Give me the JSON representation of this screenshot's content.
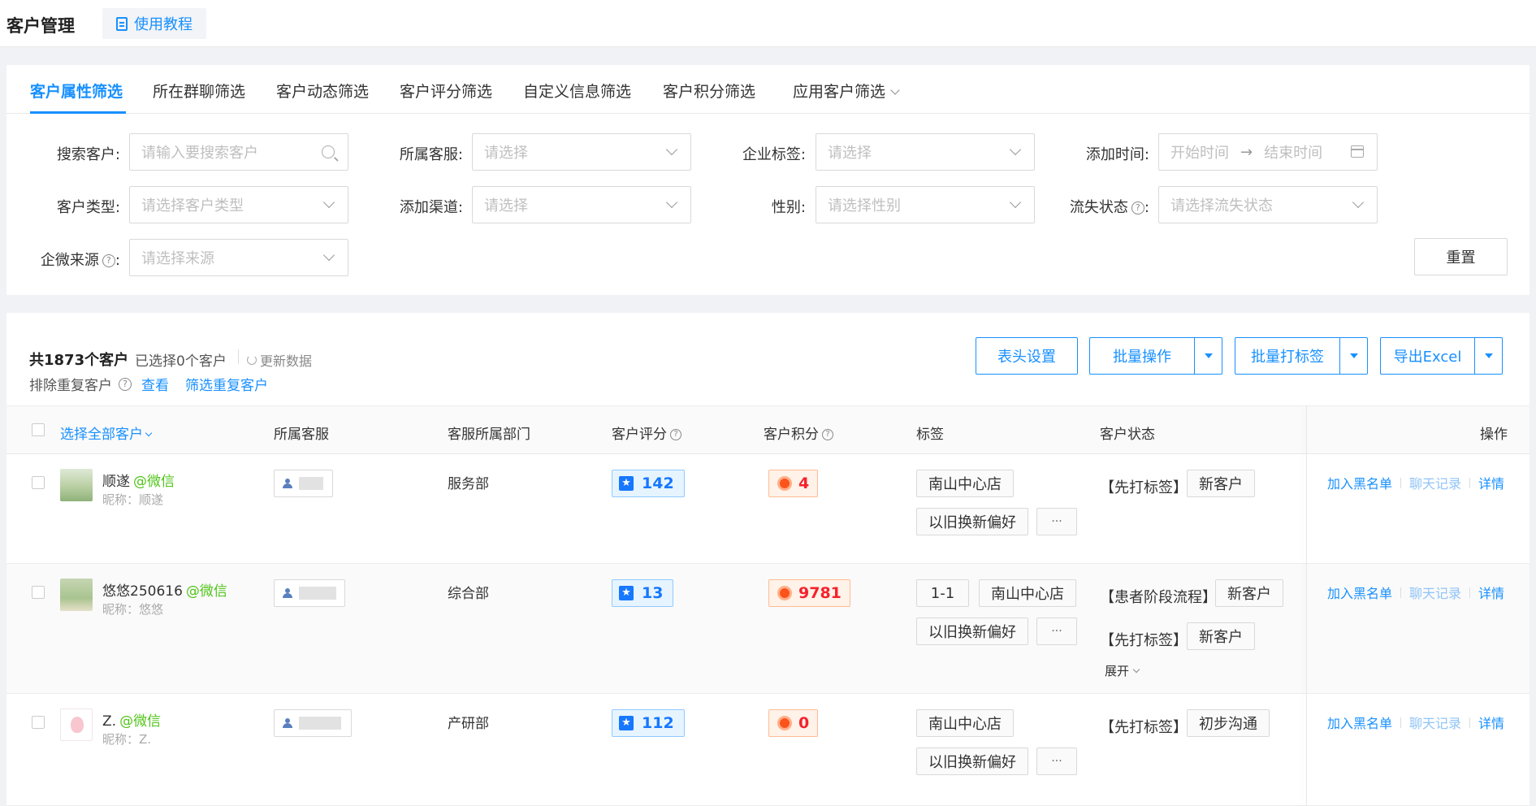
{
  "header": {
    "title": "客户管理",
    "tutorial": "使用教程"
  },
  "filter_tabs": [
    "客户属性筛选",
    "所在群聊筛选",
    "客户动态筛选",
    "客户评分筛选",
    "自定义信息筛选",
    "客户积分筛选",
    "应用客户筛选"
  ],
  "filters": {
    "search_label": "搜索客户:",
    "search_placeholder": "请输入要搜索客户",
    "agent_label": "所属客服:",
    "agent_placeholder": "请选择",
    "corp_tag_label": "企业标签:",
    "corp_tag_placeholder": "请选择",
    "add_time_label": "添加时间:",
    "start_time": "开始时间",
    "arrow": "→",
    "end_time": "结束时间",
    "type_label": "客户类型:",
    "type_placeholder": "请选择客户类型",
    "channel_label": "添加渠道:",
    "channel_placeholder": "请选择",
    "gender_label": "性别:",
    "gender_placeholder": "请选择性别",
    "churn_label": "流失状态",
    "churn_placeholder": "请选择流失状态",
    "source_label": "企微来源",
    "source_placeholder": "请选择来源",
    "colon": ":",
    "reset": "重置"
  },
  "list": {
    "total": "共1873个客户",
    "selected": "已选择0个客户",
    "refresh": "更新数据",
    "exclude": "排除重复客户",
    "view": "查看",
    "filter_dup": "筛选重复客户",
    "buttons": {
      "header_settings": "表头设置",
      "batch_ops": "批量操作",
      "batch_tag": "批量打标签",
      "export": "导出Excel"
    }
  },
  "columns": {
    "select_all": "选择全部客户",
    "agent": "所属客服",
    "dept": "客服所属部门",
    "score": "客户评分",
    "points": "客户积分",
    "tags": "标签",
    "status": "客户状态",
    "ops": "操作"
  },
  "rows": [
    {
      "name": "顺遂",
      "channel": "@微信",
      "nickname": "昵称：顺遂",
      "dept": "服务部",
      "score": "142",
      "points": "4",
      "tags": [
        "南山中心店",
        "以旧换新偏好"
      ],
      "more": "···",
      "stages": [
        {
          "stage": "【先打标签】",
          "status": "新客户"
        }
      ]
    },
    {
      "name": "悠悠250616",
      "channel": "@微信",
      "nickname": "昵称：悠悠",
      "dept": "综合部",
      "score": "13",
      "points": "9781",
      "tags": [
        "1-1",
        "南山中心店",
        "以旧换新偏好"
      ],
      "more": "···",
      "stages": [
        {
          "stage": "【患者阶段流程】",
          "status": "新客户"
        },
        {
          "stage": "【先打标签】",
          "status": "新客户"
        }
      ],
      "expand": "展开"
    },
    {
      "name": "Z.",
      "channel": "@微信",
      "nickname": "昵称：Z.",
      "dept": "产研部",
      "score": "112",
      "points": "0",
      "tags": [
        "南山中心店",
        "以旧换新偏好"
      ],
      "more": "···",
      "stages": [
        {
          "stage": "【先打标签】",
          "status": "初步沟通"
        }
      ]
    }
  ],
  "row_actions": {
    "blacklist": "加入黑名单",
    "chat": "聊天记录",
    "detail": "详情"
  },
  "colors": {
    "primary": "#1890ff",
    "wechat": "#52c41a",
    "points": "#f5222d"
  },
  "icons": {
    "tutorial": "document-icon",
    "search": "search-icon",
    "calendar": "calendar-icon",
    "help": "question-icon",
    "refresh": "refresh-icon",
    "score": "star-icon",
    "points": "coin-icon",
    "agent": "person-icon"
  },
  "help_glyph": "?"
}
